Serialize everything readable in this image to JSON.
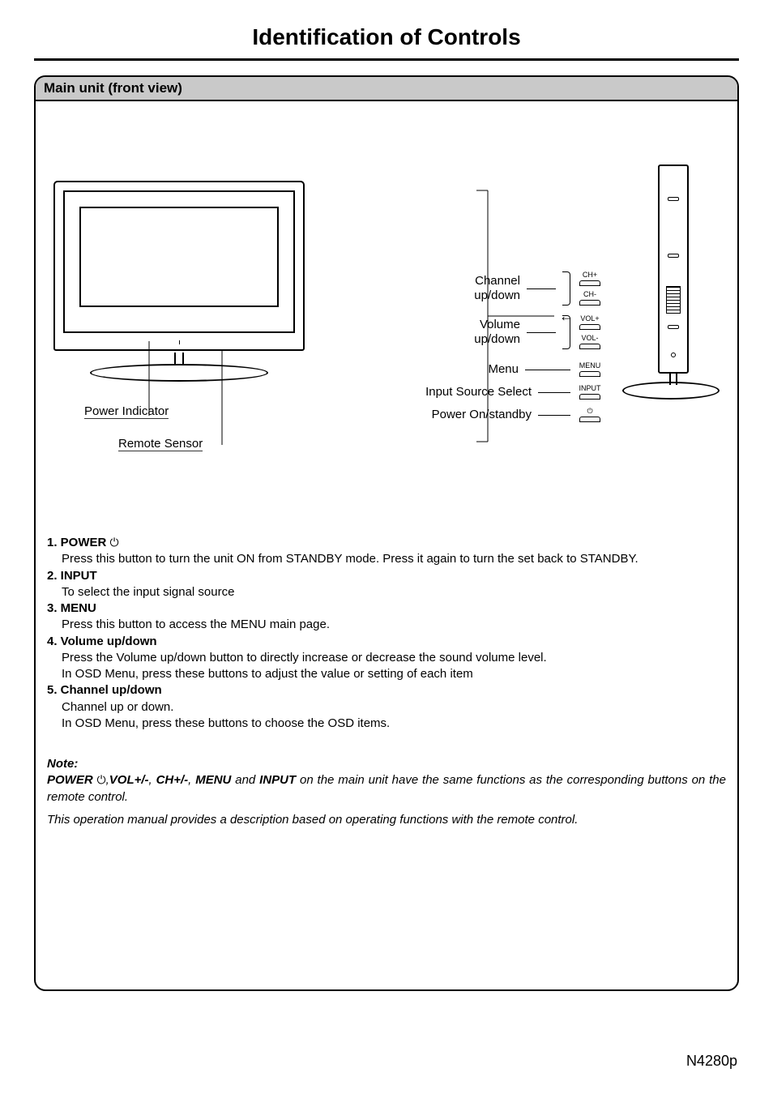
{
  "title": "Identification of Controls",
  "panel_header": "Main unit (front view)",
  "front_labels": {
    "power_indicator": "Power Indicator",
    "remote_sensor": "Remote Sensor"
  },
  "callouts": {
    "channel": "Channel\nup/down",
    "volume": "Volume\nup/down",
    "menu": "Menu",
    "input": "Input Source Select",
    "power": "Power On/standby"
  },
  "btn_caps": {
    "ch_plus": "CH+",
    "ch_minus": "CH-",
    "vol_plus": "VOL+",
    "vol_minus": "VOL-",
    "menu": "MENU",
    "input": "INPUT",
    "power": "⏻"
  },
  "items": {
    "1": {
      "head": "1. POWER",
      "body": "Press this button to turn the unit ON from STANDBY mode. Press it again to turn the set back to STANDBY."
    },
    "2": {
      "head": "2. INPUT",
      "body": "To select the input signal source"
    },
    "3": {
      "head": "3. MENU",
      "body": "Press this button to access the MENU main page."
    },
    "4": {
      "head": "4. Volume up/down",
      "body1": "Press the Volume up/down  button to directly increase or decrease the sound volume level.",
      "body2": "In OSD Menu, press these buttons to adjust the value or setting of each item"
    },
    "5": {
      "head": "5. Channel up/down",
      "body1": "Channel up or down.",
      "body2": "In OSD Menu, press these buttons to choose the OSD items."
    }
  },
  "note": {
    "label": "Note:",
    "strong_parts": {
      "power": "POWER",
      "vol": "VOL+/-",
      "ch": "CH+/-",
      "menu": "MENU",
      "input": "INPUT"
    },
    "rest1": " on the main unit have the same functions as the corresponding buttons on the remote control.",
    "line2": "This operation manual provides a description based on operating functions with the remote control."
  },
  "model": "N4280p"
}
